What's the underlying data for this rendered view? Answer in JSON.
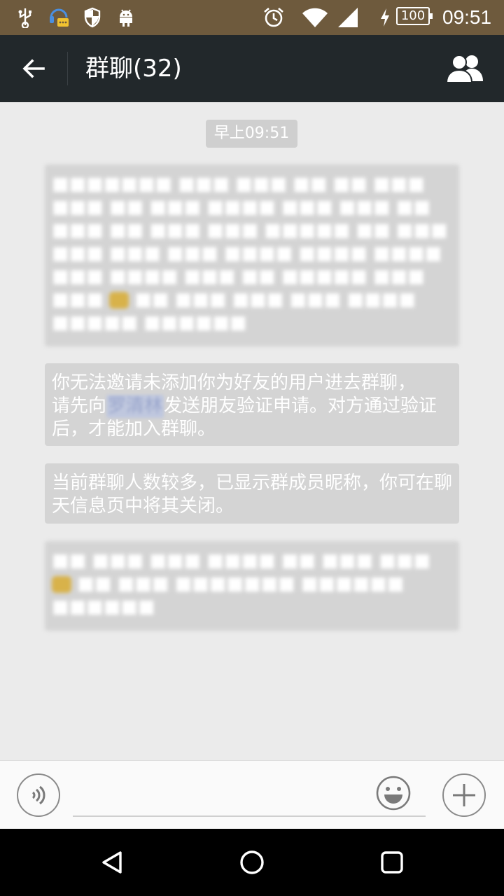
{
  "status_bar": {
    "battery": "100",
    "time": "09:51",
    "icons": [
      "usb-icon",
      "notification-app-icon",
      "shield-icon",
      "android-icon",
      "alarm-icon",
      "wifi-icon",
      "signal-icon",
      "charging-icon"
    ]
  },
  "app_bar": {
    "title": "群聊(32)",
    "back_icon": "arrow-left-icon",
    "members_icon": "group-members-icon"
  },
  "chat": {
    "timestamp": "早上09:51",
    "messages": [
      {
        "text": "你无法邀请未添加你为好友的用户进去群聊，",
        "text2": "请先向",
        "name": "罗清林",
        "text3": "发送朋友验证申请。对方通过验证后，才能加入群聊。"
      },
      {
        "text": "当前群聊人数较多，已显示群成员昵称，你可在聊天信息页中将其关闭。"
      }
    ]
  },
  "input_bar": {
    "voice_icon": "voice-icon",
    "emoji_icon": "smiley-icon",
    "add_icon": "plus-icon",
    "placeholder": ""
  },
  "nav_bar": {
    "icons": [
      "back-triangle-icon",
      "home-circle-icon",
      "recents-square-icon"
    ]
  },
  "colors": {
    "status_bar": "#6e5a3d",
    "app_bar": "#22282b",
    "chat_bg": "#ebebeb",
    "system_message_bg": "#d4d4d4"
  }
}
